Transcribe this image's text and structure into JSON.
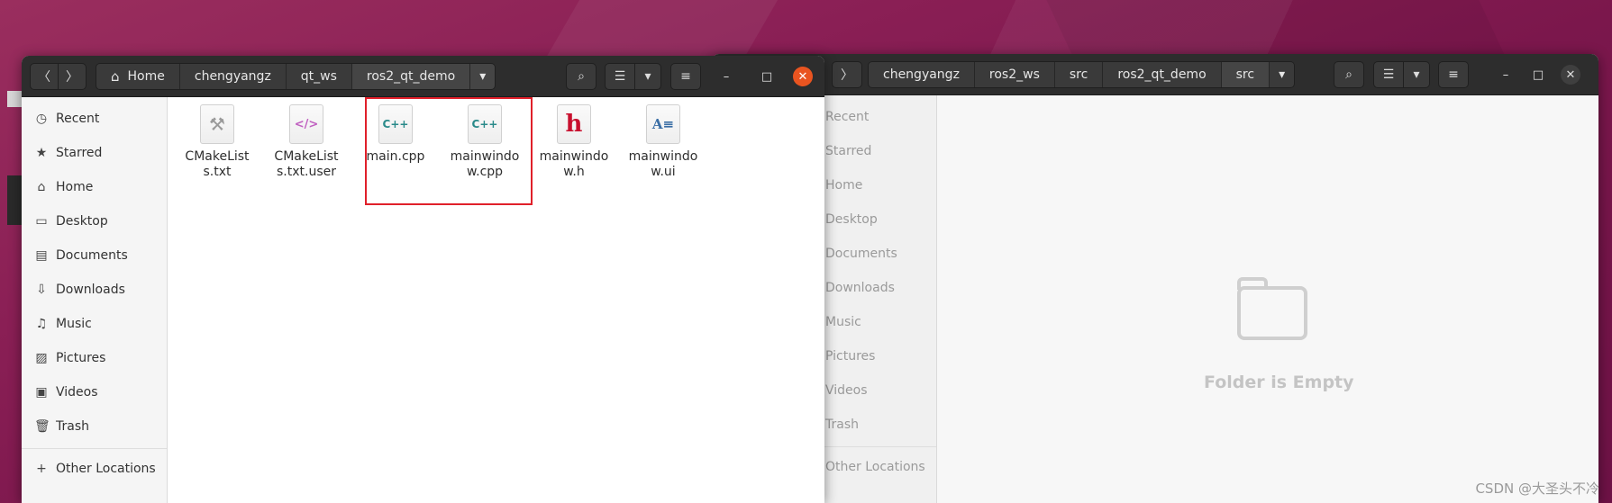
{
  "left_window": {
    "nav": {
      "back_label": "〈",
      "forward_label": "〉"
    },
    "path": [
      {
        "label": "Home",
        "icon": "home-icon"
      },
      {
        "label": "chengyangz"
      },
      {
        "label": "qt_ws"
      },
      {
        "label": "ros2_qt_demo"
      }
    ],
    "path_menu_label": "▾",
    "toolbar": {
      "search_glyph": "⌕",
      "list_glyph": "☰",
      "view_menu_glyph": "▾",
      "menu_glyph": "≡"
    },
    "controls": {
      "minimize": "–",
      "maximize": "□",
      "close": "✕"
    },
    "sidebar": [
      {
        "label": "Recent",
        "glyph": "◷"
      },
      {
        "label": "Starred",
        "glyph": "★"
      },
      {
        "label": "Home",
        "glyph": "⌂"
      },
      {
        "label": "Desktop",
        "glyph": "▭"
      },
      {
        "label": "Documents",
        "glyph": "▤"
      },
      {
        "label": "Downloads",
        "glyph": "⇩"
      },
      {
        "label": "Music",
        "glyph": "♫"
      },
      {
        "label": "Pictures",
        "glyph": "▨"
      },
      {
        "label": "Videos",
        "glyph": "▣"
      },
      {
        "label": "Trash",
        "glyph": "🗑"
      }
    ],
    "other_locations": {
      "label": "Other Locations",
      "glyph": "+"
    },
    "files": [
      {
        "name": "CMakeLists.txt",
        "icon": "⚒",
        "color": "#9a9a9a"
      },
      {
        "name": "CMakeLists.txt.user",
        "icon": "</>",
        "color": "#c060c0"
      },
      {
        "name": "main.cpp",
        "icon": "C++",
        "color": "#2a8a8a"
      },
      {
        "name": "mainwindow.cpp",
        "icon": "C++",
        "color": "#2a8a8a"
      },
      {
        "name": "mainwindow.h",
        "icon": "h",
        "color": "#c8102e"
      },
      {
        "name": "mainwindow.ui",
        "icon": "A≡",
        "color": "#3a6ea5"
      }
    ]
  },
  "right_window": {
    "nav": {
      "forward_label": "〉"
    },
    "path": [
      {
        "label": "chengyangz"
      },
      {
        "label": "ros2_ws"
      },
      {
        "label": "src"
      },
      {
        "label": "ros2_qt_demo"
      },
      {
        "label": "src"
      }
    ],
    "path_menu_label": "▾",
    "toolbar": {
      "search_glyph": "⌕",
      "list_glyph": "☰",
      "view_menu_glyph": "▾",
      "menu_glyph": "≡"
    },
    "controls": {
      "minimize": "–",
      "maximize": "□",
      "close": "✕"
    },
    "sidebar": [
      {
        "label": "Recent"
      },
      {
        "label": "Starred"
      },
      {
        "label": "Home"
      },
      {
        "label": "Desktop"
      },
      {
        "label": "Documents"
      },
      {
        "label": "Downloads"
      },
      {
        "label": "Music"
      },
      {
        "label": "Pictures"
      },
      {
        "label": "Videos"
      },
      {
        "label": "Trash"
      }
    ],
    "other_locations": {
      "label": "Other Locations"
    },
    "empty_message": "Folder is Empty"
  },
  "watermark": "CSDN @大圣头不冷"
}
